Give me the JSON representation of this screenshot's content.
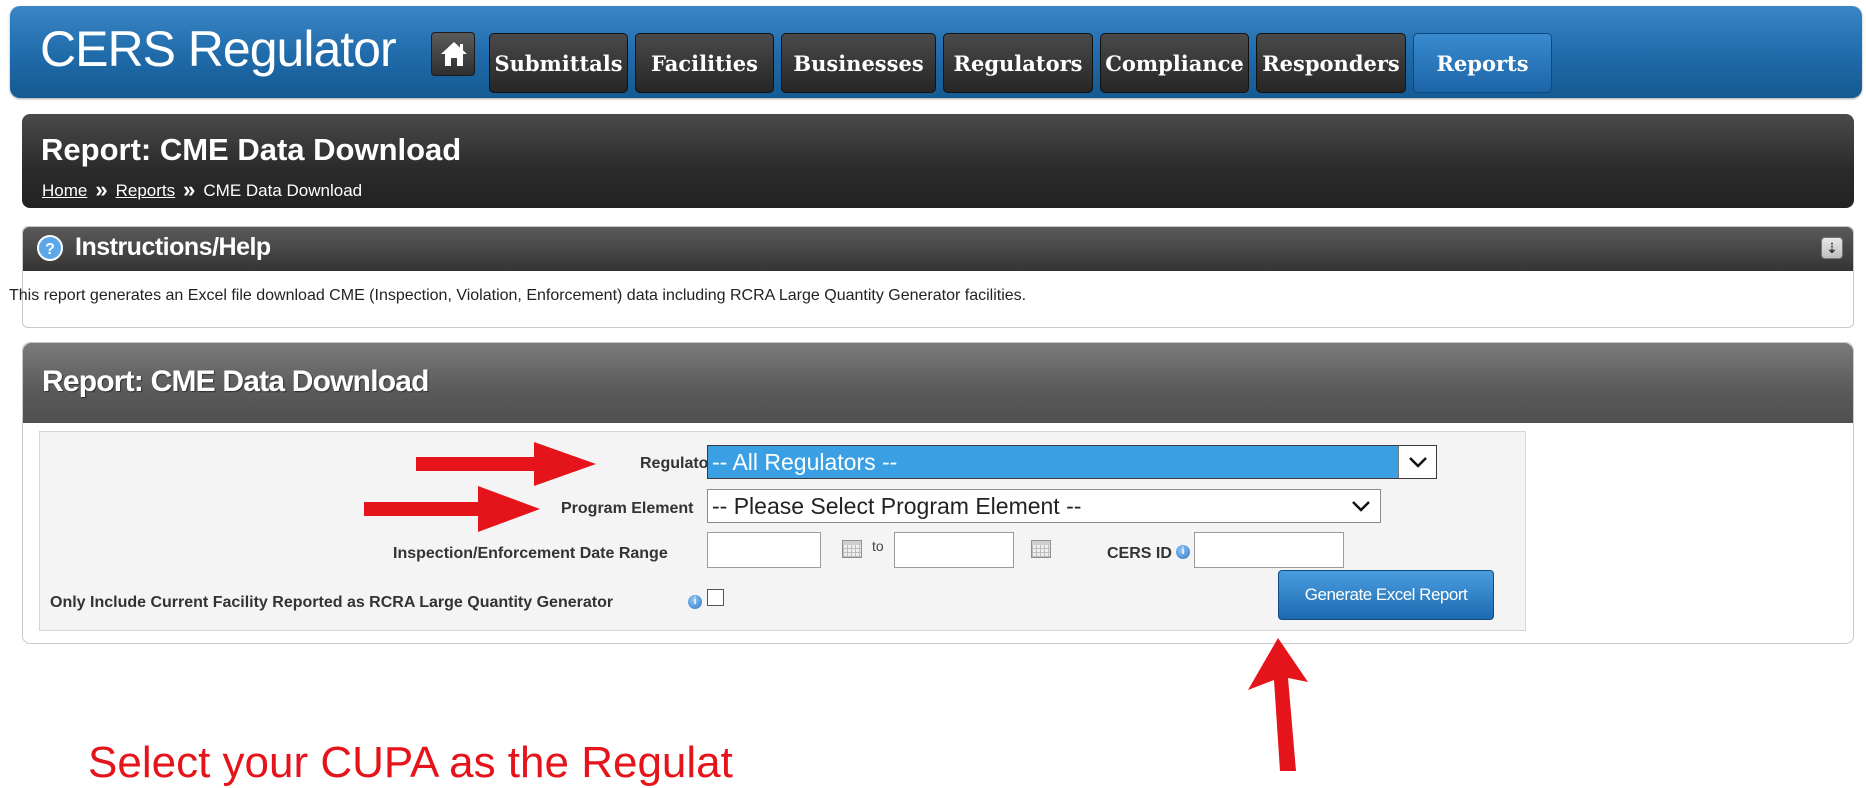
{
  "app": {
    "brand": "CERS Regulator",
    "nav": [
      {
        "label": "Submittals",
        "active": false
      },
      {
        "label": "Facilities",
        "active": false
      },
      {
        "label": "Businesses",
        "active": false
      },
      {
        "label": "Regulators",
        "active": false
      },
      {
        "label": "Compliance",
        "active": false
      },
      {
        "label": "Responders",
        "active": false
      },
      {
        "label": "Reports",
        "active": true
      }
    ],
    "home_icon": "home-icon"
  },
  "page": {
    "title": "Report: CME Data Download",
    "breadcrumb": [
      {
        "label": "Home",
        "link": true
      },
      {
        "label": "Reports",
        "link": true
      },
      {
        "label": "CME Data Download",
        "link": false
      }
    ],
    "breadcrumb_sep": "»"
  },
  "help": {
    "title": "Instructions/Help",
    "text": "This report generates an Excel file download CME (Inspection, Violation, Enforcement) data including RCRA Large Quantity Generator facilities."
  },
  "report": {
    "title": "Report: CME Data Download",
    "regulator_label": "Regulator",
    "regulator_value": "-- All Regulators --",
    "program_label": "Program Element",
    "program_value": "-- Please Select Program Element --",
    "date_range_label": "Inspection/Enforcement Date Range",
    "to_label": "to",
    "cers_id_label": "CERS ID",
    "rcra_label": "Only Include Current Facility Reported as RCRA Large Quantity Generator",
    "generate_button": "Generate Excel Report"
  },
  "annotation": {
    "note": "Select your CUPA as the Regulat",
    "color": "#e5141a"
  },
  "colors": {
    "nav_blue": "#1f6aa9",
    "selected_blue": "#3aa0e3",
    "header_dark": "#2a2a2a"
  }
}
